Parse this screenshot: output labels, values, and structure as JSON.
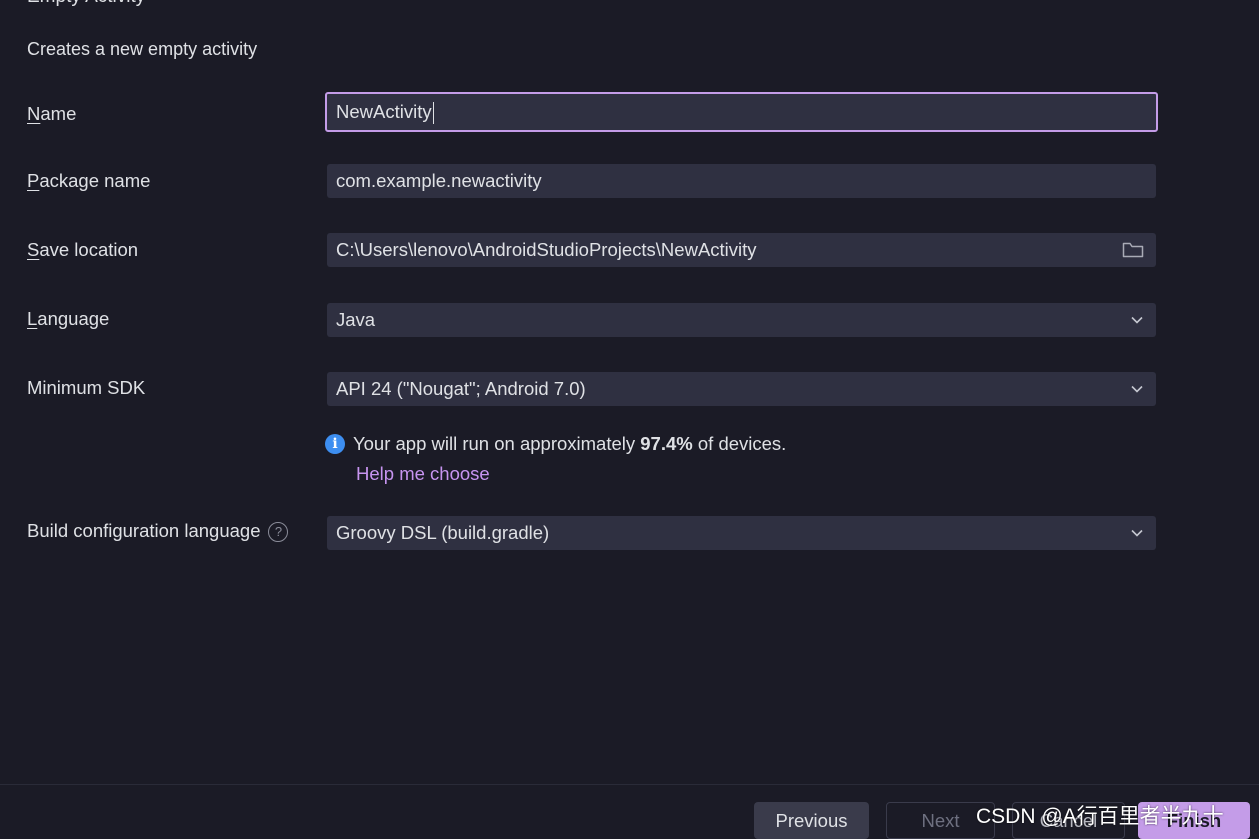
{
  "header": {
    "title_partial": "Empty Activity",
    "subtitle": "Creates a new empty activity"
  },
  "form": {
    "name": {
      "label_mnemonic": "N",
      "label_rest": "ame",
      "value": "NewActivity"
    },
    "package": {
      "label_mnemonic": "P",
      "label_rest": "ackage name",
      "value": "com.example.newactivity"
    },
    "save_location": {
      "label_mnemonic": "S",
      "label_rest": "ave location",
      "value": "C:\\Users\\lenovo\\AndroidStudioProjects\\NewActivity",
      "icon": "folder-icon"
    },
    "language": {
      "label_mnemonic": "L",
      "label_rest": "anguage",
      "value": "Java"
    },
    "min_sdk": {
      "label": "Minimum SDK",
      "value": "API 24 (\"Nougat\"; Android 7.0)"
    },
    "sdk_info": {
      "icon": "info-icon",
      "text_before": "Your app will run on approximately",
      "percent": "97.4%",
      "text_after": "of devices.",
      "help_link": "Help me choose"
    },
    "build_config": {
      "label": "Build configuration language",
      "help_icon": "question-icon",
      "value": "Groovy DSL (build.gradle)"
    }
  },
  "footer": {
    "previous": "Previous",
    "next": "Next",
    "cancel": "Cancel",
    "finish": "Finish"
  },
  "watermark": "CSDN @A行百里者半九十",
  "colors": {
    "background": "#1b1b26",
    "field_bg": "#2f3041",
    "accent": "#c49ce8",
    "link": "#c794f0",
    "info_blue": "#3d8ef0"
  }
}
